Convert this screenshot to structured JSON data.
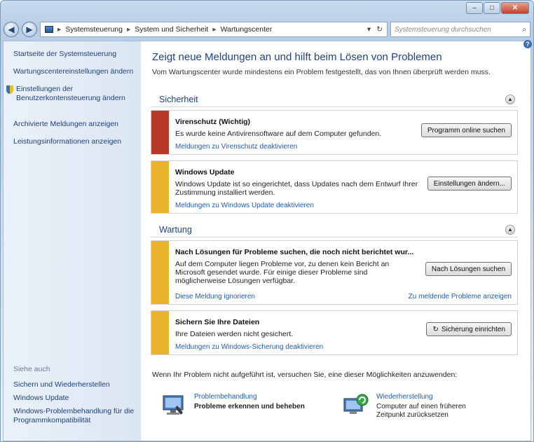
{
  "window": {
    "min": "–",
    "max": "□",
    "close": "✕"
  },
  "nav": {
    "back": "◀",
    "forward": "▶",
    "address": [
      "Systemsteuerung",
      "System und Sicherheit",
      "Wartungscenter"
    ],
    "search_placeholder": "Systemsteuerung durchsuchen",
    "search_icon": "⌕",
    "refresh": "↻",
    "dropdown": "▾"
  },
  "sidebar": {
    "top_items": [
      "Startseite der Systemsteuerung",
      "Wartungscentereinstellungen ändern",
      "Einstellungen der Benutzerkontensteuerung ändern",
      "Archivierte Meldungen anzeigen",
      "Leistungsinformationen anzeigen"
    ],
    "see_also_header": "Siehe auch",
    "bottom_items": [
      "Sichern und Wiederherstellen",
      "Windows Update",
      "Windows-Problembehandlung für die Programmkompatibilität"
    ]
  },
  "main": {
    "help": "?",
    "title": "Zeigt neue Meldungen an und hilft beim Lösen von Problemen",
    "subtitle": "Vom Wartungscenter wurde mindestens ein Problem festgestellt, das von Ihnen überprüft werden muss.",
    "security": {
      "header": "Sicherheit",
      "items": [
        {
          "title": "Virenschutz (Wichtig)",
          "desc": "Es wurde keine Antivirensoftware auf dem Computer gefunden.",
          "link": "Meldungen zu Virenschutz deaktivieren",
          "button": "Programm online suchen",
          "color": "#b8392a"
        },
        {
          "title": "Windows Update",
          "desc": "Windows Update ist so eingerichtet, dass Updates nach dem Entwurf Ihrer Zustimmung installiert werden.",
          "link": "Meldungen zu Windows Update deaktivieren",
          "button": "Einstellungen ändern...",
          "color": "#e8b32a"
        }
      ]
    },
    "maintenance": {
      "header": "Wartung",
      "items": [
        {
          "title": "Nach Lösungen für Probleme suchen, die noch nicht berichtet wur...",
          "desc": "Auf dem Computer liegen Probleme vor, zu denen kein Bericht an Microsoft gesendet wurde. Für einige dieser Probleme sind möglicherweise Lösungen verfügbar.",
          "link": "Diese Meldung ignorieren",
          "link2": "Zu meldende Probleme anzeigen",
          "button": "Nach Lösungen suchen",
          "color": "#e8b32a"
        },
        {
          "title": "Sichern Sie Ihre Dateien",
          "desc": "Ihre Dateien werden nicht gesichert.",
          "link": "Meldungen zu Windows-Sicherung deaktivieren",
          "button": "Sicherung einrichten",
          "color": "#e8b32a"
        }
      ]
    },
    "footer_note": "Wenn Ihr Problem nicht aufgeführt ist, versuchen Sie, eine dieser Möglichkeiten anzuwenden:",
    "tools": [
      {
        "link": "Problembehandlung",
        "desc": "Probleme erkennen und beheben",
        "icon": "troubleshoot-icon"
      },
      {
        "link": "Wiederherstellung",
        "desc": "Computer auf einen früheren Zeitpunkt zurücksetzen",
        "icon": "restore-icon"
      }
    ]
  }
}
